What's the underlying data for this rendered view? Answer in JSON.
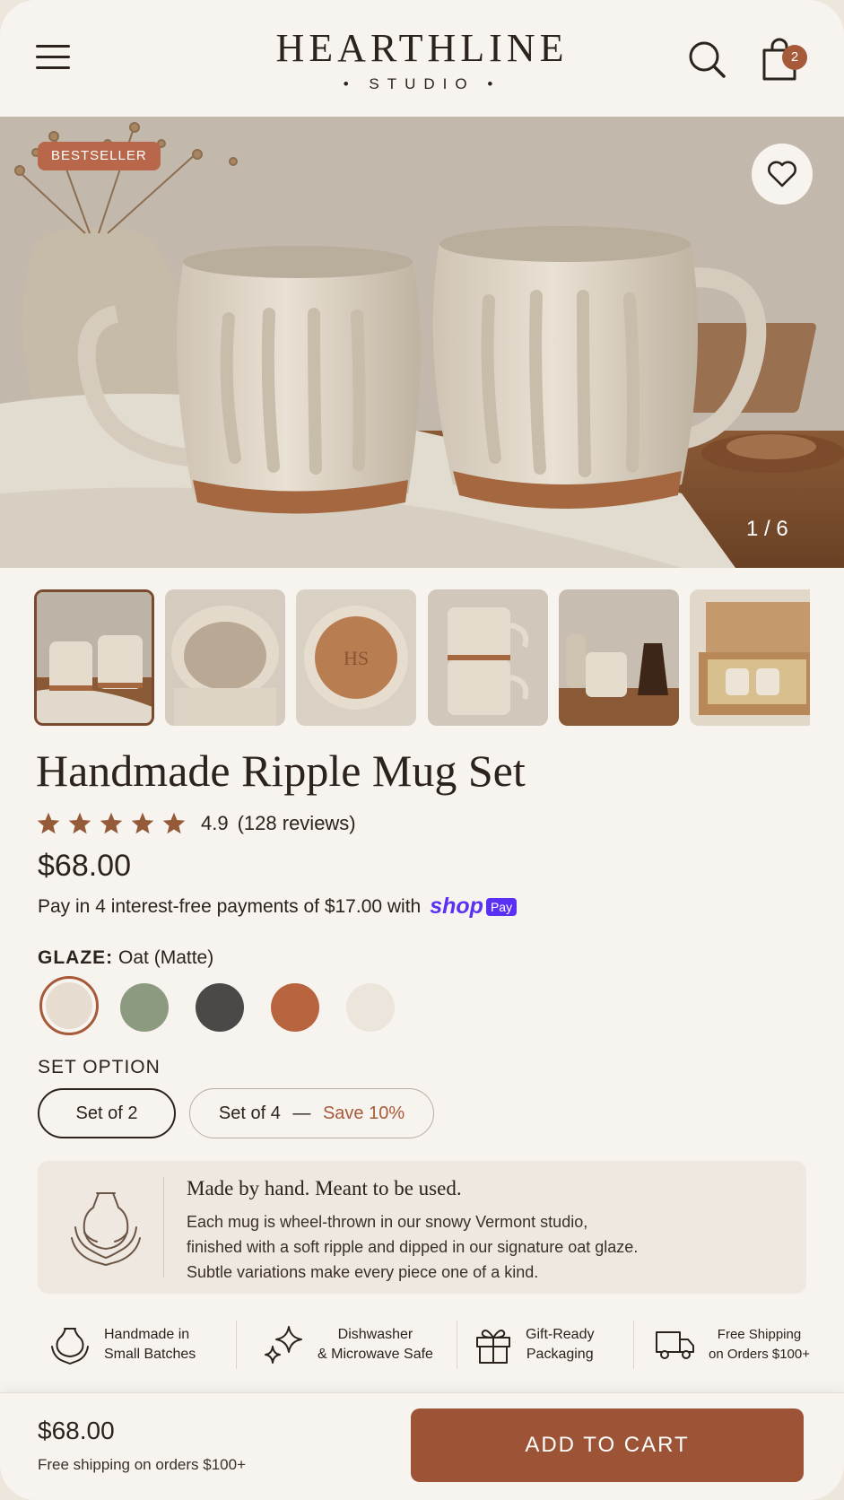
{
  "header": {
    "brand": "HEARTHLINE",
    "brand_sub": "• STUDIO •",
    "cart_count": "2",
    "icons": [
      "menu-icon",
      "search-icon",
      "bag-icon"
    ]
  },
  "hero": {
    "badge": "BESTSELLER",
    "counter": "1 / 6",
    "icons": [
      "heart-icon"
    ]
  },
  "thumbnails": [
    {
      "label": "two-mugs-on-linen",
      "active": true
    },
    {
      "label": "mug-interior"
    },
    {
      "label": "mug-base-stamp"
    },
    {
      "label": "stacked-mugs"
    },
    {
      "label": "mug-with-coffee"
    },
    {
      "label": "gift-box"
    }
  ],
  "thumb_stamp": "HS",
  "product": {
    "title": "Handmade Ripple Mug Set",
    "rating": "4.9",
    "rating_count": "(128 reviews)",
    "stars": 5,
    "price": "$68.00",
    "installments_text": "Pay in 4 interest-free payments of $17.00 with",
    "shop_word": "shop",
    "shop_pay_badge": "Pay"
  },
  "glaze": {
    "label": "GLAZE:",
    "selected": "Oat",
    "finish": "(Matte)",
    "options": [
      {
        "name": "Oat",
        "color": "#e6ddd0"
      },
      {
        "name": "Sage",
        "color": "#8c9a80"
      },
      {
        "name": "Charcoal",
        "color": "#4a4947"
      },
      {
        "name": "Terracotta",
        "color": "#b8643f"
      },
      {
        "name": "Speckled White",
        "color": "#ebe5dc"
      }
    ]
  },
  "set_option": {
    "label": "SET OPTION",
    "option1": "Set of 2",
    "option2": "Set of 4",
    "option2_dash": "—",
    "option2_save": "Save 10%"
  },
  "story": {
    "title": "Made by hand. Meant to be used.",
    "line1": "Each mug is wheel-thrown in our snowy Vermont studio,",
    "line2": "finished with a soft ripple and dipped in our signature oat glaze.",
    "line3": "Subtle variations make every piece one of a kind."
  },
  "features": [
    {
      "line1": "Handmade in",
      "line2": "Small Batches",
      "icon": "hands-vase-icon"
    },
    {
      "line1": "Dishwasher",
      "line2": "& Microwave Safe",
      "icon": "sparkle-icon"
    },
    {
      "line1": "Gift-Ready",
      "line2": "Packaging",
      "icon": "gift-icon"
    },
    {
      "line1": "Free Shipping",
      "line2": "on Orders $100+",
      "icon": "truck-icon"
    }
  ],
  "footer": {
    "price": "$68.00",
    "shipping": "Free shipping on orders $100+",
    "cta": "ADD TO CART"
  },
  "colors": {
    "accent": "#9d5436",
    "background": "#f7f3ee",
    "badge": "#b8674a",
    "shop_pay": "#5a31f4"
  }
}
